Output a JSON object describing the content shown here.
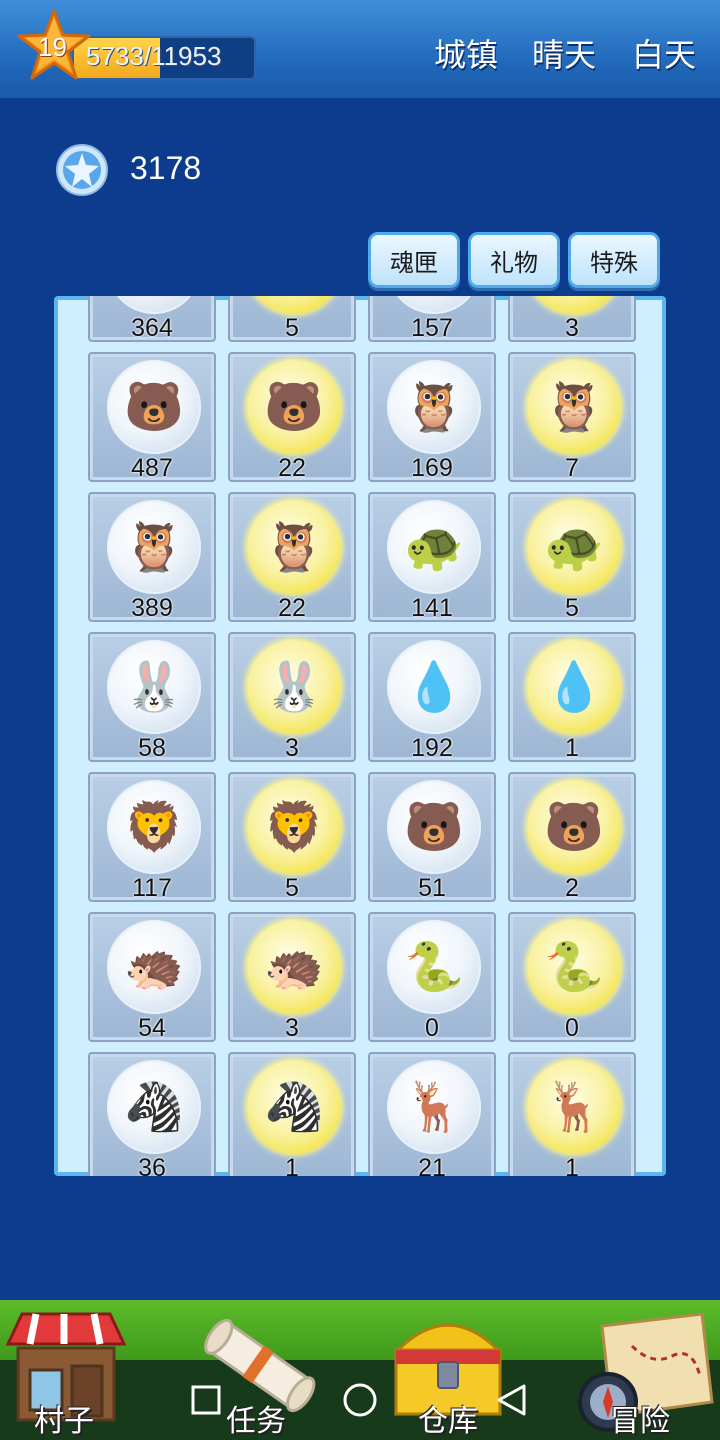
{
  "header": {
    "level": "19",
    "xp_text": "5733/11953",
    "xp_fraction": 0.48,
    "location": "城镇",
    "weather": "晴天",
    "time_of_day": "白天"
  },
  "currency": {
    "icon": "star-gem-icon",
    "amount": "3178"
  },
  "tabs": [
    {
      "label": "魂匣"
    },
    {
      "label": "礼物"
    },
    {
      "label": "特殊"
    }
  ],
  "inventory": [
    {
      "count": "364",
      "gold": false,
      "icon": "bear-icon"
    },
    {
      "count": "5",
      "gold": true,
      "icon": "bear-icon"
    },
    {
      "count": "157",
      "gold": false,
      "icon": "bear-icon"
    },
    {
      "count": "3",
      "gold": true,
      "icon": "bear-icon"
    },
    {
      "count": "487",
      "gold": false,
      "icon": "bear-icon"
    },
    {
      "count": "22",
      "gold": true,
      "icon": "bear-icon"
    },
    {
      "count": "169",
      "gold": false,
      "icon": "owl-icon"
    },
    {
      "count": "7",
      "gold": true,
      "icon": "owl-icon"
    },
    {
      "count": "389",
      "gold": false,
      "icon": "owl-icon"
    },
    {
      "count": "22",
      "gold": true,
      "icon": "owl-icon"
    },
    {
      "count": "141",
      "gold": false,
      "icon": "turtle-icon"
    },
    {
      "count": "5",
      "gold": true,
      "icon": "turtle-icon"
    },
    {
      "count": "58",
      "gold": false,
      "icon": "rabbit-icon"
    },
    {
      "count": "3",
      "gold": true,
      "icon": "rabbit-icon"
    },
    {
      "count": "192",
      "gold": false,
      "icon": "spirit-icon"
    },
    {
      "count": "1",
      "gold": true,
      "icon": "spirit-icon"
    },
    {
      "count": "117",
      "gold": false,
      "icon": "lion-icon"
    },
    {
      "count": "5",
      "gold": true,
      "icon": "lion-icon"
    },
    {
      "count": "51",
      "gold": false,
      "icon": "cub-icon"
    },
    {
      "count": "2",
      "gold": true,
      "icon": "cub-icon"
    },
    {
      "count": "54",
      "gold": false,
      "icon": "armadillo-icon"
    },
    {
      "count": "3",
      "gold": true,
      "icon": "armadillo-icon"
    },
    {
      "count": "0",
      "gold": false,
      "icon": "snake-icon"
    },
    {
      "count": "0",
      "gold": true,
      "icon": "snake-icon"
    },
    {
      "count": "36",
      "gold": false,
      "icon": "zebra-icon"
    },
    {
      "count": "1",
      "gold": true,
      "icon": "zebra-icon"
    },
    {
      "count": "21",
      "gold": false,
      "icon": "deer-icon"
    },
    {
      "count": "1",
      "gold": true,
      "icon": "deer-icon"
    }
  ],
  "bottom_nav": [
    {
      "label": "村子",
      "icon": "shop-icon"
    },
    {
      "label": "任务",
      "icon": "scroll-icon"
    },
    {
      "label": "仓库",
      "icon": "treasure-chest-icon"
    },
    {
      "label": "冒险",
      "icon": "map-icon"
    }
  ],
  "system_nav": [
    {
      "icon": "square-recents-icon"
    },
    {
      "icon": "circle-home-icon"
    },
    {
      "icon": "triangle-back-icon"
    }
  ]
}
